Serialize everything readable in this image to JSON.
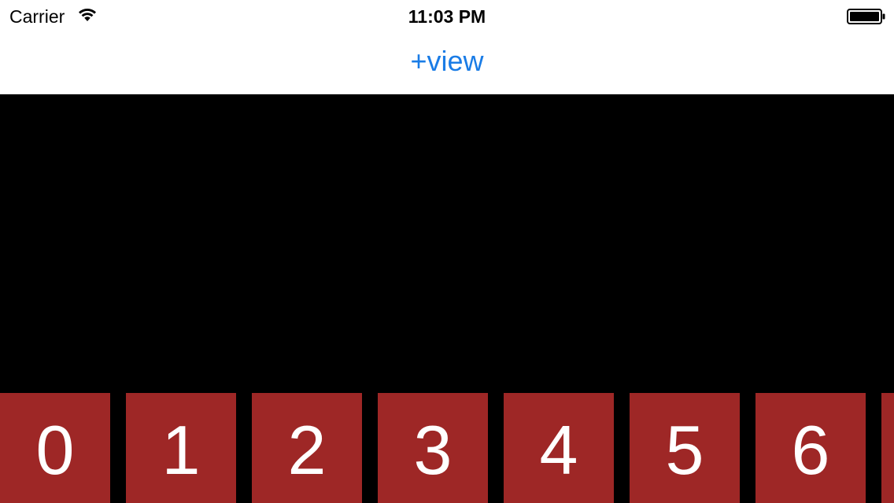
{
  "status_bar": {
    "carrier": "Carrier",
    "time": "11:03 PM",
    "wifi_icon": "wifi-icon",
    "battery_icon": "battery-full-icon"
  },
  "nav_bar": {
    "add_view_label": "+view",
    "tint_color": "#1a7ce6"
  },
  "tiles": {
    "color": "#9e2726",
    "labels": [
      "0",
      "1",
      "2",
      "3",
      "4",
      "5",
      "6",
      ""
    ]
  }
}
